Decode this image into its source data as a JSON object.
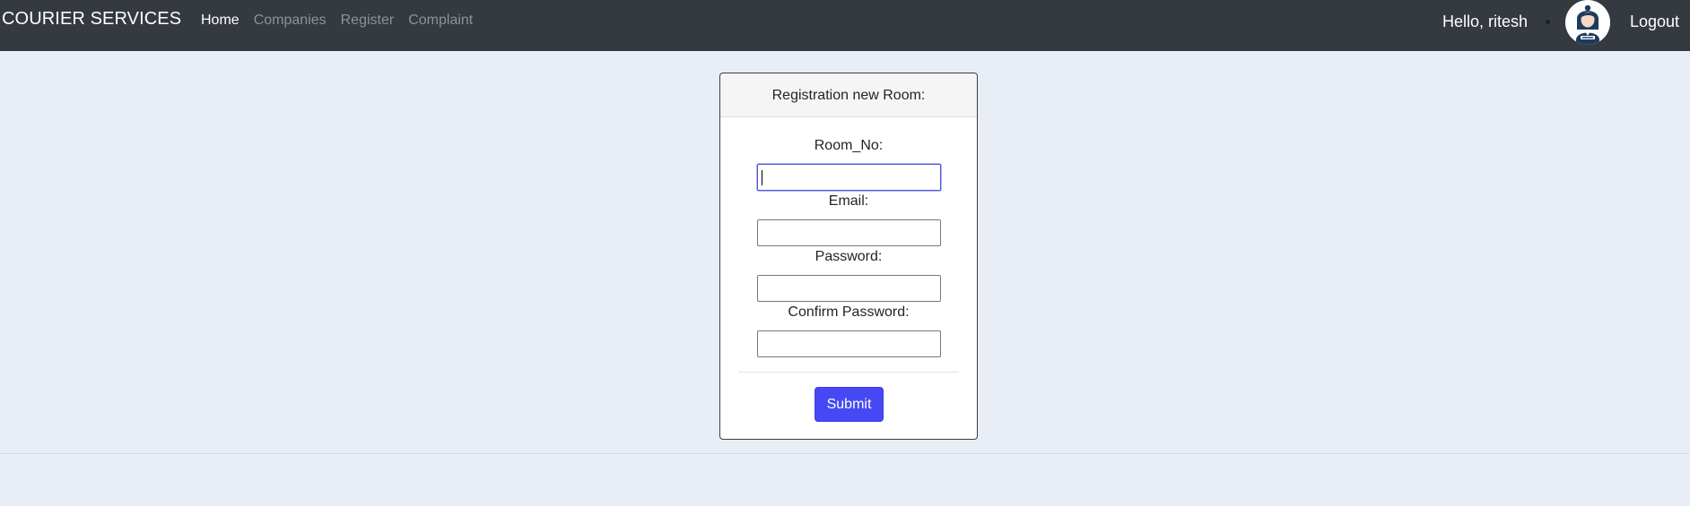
{
  "navbar": {
    "brand": "COURIER SERVICES",
    "links": [
      {
        "label": "Home",
        "active": true
      },
      {
        "label": "Companies",
        "active": false
      },
      {
        "label": "Register",
        "active": false
      },
      {
        "label": "Complaint",
        "active": false
      }
    ],
    "greeting": "Hello, ritesh",
    "avatar_icon": "admin-avatar-icon",
    "logout_label": "Logout"
  },
  "form": {
    "title": "Registration new Room:",
    "fields": [
      {
        "label": "Room_No:",
        "value": "",
        "focused": true
      },
      {
        "label": "Email:",
        "value": "",
        "focused": false
      },
      {
        "label": "Password:",
        "value": "",
        "focused": false
      },
      {
        "label": "Confirm Password:",
        "value": "",
        "focused": false
      }
    ],
    "submit_label": "Submit"
  },
  "colors": {
    "navbar_bg": "#343a40",
    "page_bg": "#e9edf5",
    "submit_bg": "#4649f3",
    "focus_border": "#4a56e2"
  }
}
